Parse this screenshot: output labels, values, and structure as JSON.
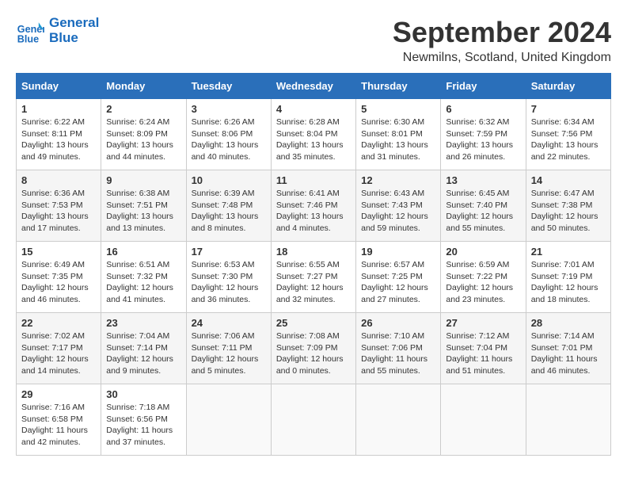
{
  "header": {
    "logo_line1": "General",
    "logo_line2": "Blue",
    "title": "September 2024",
    "subtitle": "Newmilns, Scotland, United Kingdom"
  },
  "weekdays": [
    "Sunday",
    "Monday",
    "Tuesday",
    "Wednesday",
    "Thursday",
    "Friday",
    "Saturday"
  ],
  "weeks": [
    [
      {
        "day": "1",
        "info": "Sunrise: 6:22 AM\nSunset: 8:11 PM\nDaylight: 13 hours and 49 minutes."
      },
      {
        "day": "2",
        "info": "Sunrise: 6:24 AM\nSunset: 8:09 PM\nDaylight: 13 hours and 44 minutes."
      },
      {
        "day": "3",
        "info": "Sunrise: 6:26 AM\nSunset: 8:06 PM\nDaylight: 13 hours and 40 minutes."
      },
      {
        "day": "4",
        "info": "Sunrise: 6:28 AM\nSunset: 8:04 PM\nDaylight: 13 hours and 35 minutes."
      },
      {
        "day": "5",
        "info": "Sunrise: 6:30 AM\nSunset: 8:01 PM\nDaylight: 13 hours and 31 minutes."
      },
      {
        "day": "6",
        "info": "Sunrise: 6:32 AM\nSunset: 7:59 PM\nDaylight: 13 hours and 26 minutes."
      },
      {
        "day": "7",
        "info": "Sunrise: 6:34 AM\nSunset: 7:56 PM\nDaylight: 13 hours and 22 minutes."
      }
    ],
    [
      {
        "day": "8",
        "info": "Sunrise: 6:36 AM\nSunset: 7:53 PM\nDaylight: 13 hours and 17 minutes."
      },
      {
        "day": "9",
        "info": "Sunrise: 6:38 AM\nSunset: 7:51 PM\nDaylight: 13 hours and 13 minutes."
      },
      {
        "day": "10",
        "info": "Sunrise: 6:39 AM\nSunset: 7:48 PM\nDaylight: 13 hours and 8 minutes."
      },
      {
        "day": "11",
        "info": "Sunrise: 6:41 AM\nSunset: 7:46 PM\nDaylight: 13 hours and 4 minutes."
      },
      {
        "day": "12",
        "info": "Sunrise: 6:43 AM\nSunset: 7:43 PM\nDaylight: 12 hours and 59 minutes."
      },
      {
        "day": "13",
        "info": "Sunrise: 6:45 AM\nSunset: 7:40 PM\nDaylight: 12 hours and 55 minutes."
      },
      {
        "day": "14",
        "info": "Sunrise: 6:47 AM\nSunset: 7:38 PM\nDaylight: 12 hours and 50 minutes."
      }
    ],
    [
      {
        "day": "15",
        "info": "Sunrise: 6:49 AM\nSunset: 7:35 PM\nDaylight: 12 hours and 46 minutes."
      },
      {
        "day": "16",
        "info": "Sunrise: 6:51 AM\nSunset: 7:32 PM\nDaylight: 12 hours and 41 minutes."
      },
      {
        "day": "17",
        "info": "Sunrise: 6:53 AM\nSunset: 7:30 PM\nDaylight: 12 hours and 36 minutes."
      },
      {
        "day": "18",
        "info": "Sunrise: 6:55 AM\nSunset: 7:27 PM\nDaylight: 12 hours and 32 minutes."
      },
      {
        "day": "19",
        "info": "Sunrise: 6:57 AM\nSunset: 7:25 PM\nDaylight: 12 hours and 27 minutes."
      },
      {
        "day": "20",
        "info": "Sunrise: 6:59 AM\nSunset: 7:22 PM\nDaylight: 12 hours and 23 minutes."
      },
      {
        "day": "21",
        "info": "Sunrise: 7:01 AM\nSunset: 7:19 PM\nDaylight: 12 hours and 18 minutes."
      }
    ],
    [
      {
        "day": "22",
        "info": "Sunrise: 7:02 AM\nSunset: 7:17 PM\nDaylight: 12 hours and 14 minutes."
      },
      {
        "day": "23",
        "info": "Sunrise: 7:04 AM\nSunset: 7:14 PM\nDaylight: 12 hours and 9 minutes."
      },
      {
        "day": "24",
        "info": "Sunrise: 7:06 AM\nSunset: 7:11 PM\nDaylight: 12 hours and 5 minutes."
      },
      {
        "day": "25",
        "info": "Sunrise: 7:08 AM\nSunset: 7:09 PM\nDaylight: 12 hours and 0 minutes."
      },
      {
        "day": "26",
        "info": "Sunrise: 7:10 AM\nSunset: 7:06 PM\nDaylight: 11 hours and 55 minutes."
      },
      {
        "day": "27",
        "info": "Sunrise: 7:12 AM\nSunset: 7:04 PM\nDaylight: 11 hours and 51 minutes."
      },
      {
        "day": "28",
        "info": "Sunrise: 7:14 AM\nSunset: 7:01 PM\nDaylight: 11 hours and 46 minutes."
      }
    ],
    [
      {
        "day": "29",
        "info": "Sunrise: 7:16 AM\nSunset: 6:58 PM\nDaylight: 11 hours and 42 minutes."
      },
      {
        "day": "30",
        "info": "Sunrise: 7:18 AM\nSunset: 6:56 PM\nDaylight: 11 hours and 37 minutes."
      },
      {
        "day": "",
        "info": ""
      },
      {
        "day": "",
        "info": ""
      },
      {
        "day": "",
        "info": ""
      },
      {
        "day": "",
        "info": ""
      },
      {
        "day": "",
        "info": ""
      }
    ]
  ]
}
